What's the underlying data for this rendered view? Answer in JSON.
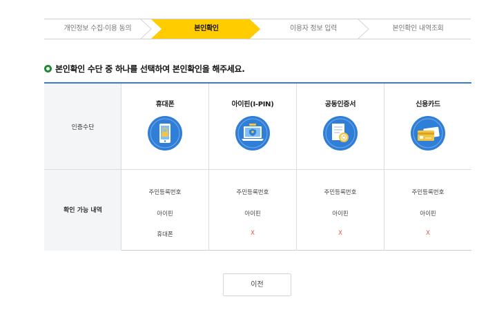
{
  "steps": [
    {
      "label": "개인정보 수집·이용 동의",
      "active": false
    },
    {
      "label": "본인확인",
      "active": true
    },
    {
      "label": "이용자 정보 입력",
      "active": false
    },
    {
      "label": "본인확인 내역조회",
      "active": false
    }
  ],
  "colors": {
    "active_step": "#ffcc00",
    "table_top_border": "#3a7bd5",
    "icon_blue": "#2f7ed8",
    "x_mark": "#e0534a",
    "heading_bullet": "#1e8a34"
  },
  "heading": "본인확인 수단 중 하나를 선택하여 본인확인을 해주세요.",
  "table": {
    "row1_label": "인증수단",
    "row2_label": "확인 가능 내역",
    "methods": [
      {
        "name": "휴대폰",
        "icon": "phone-lock-icon",
        "items": [
          "주민등록번호",
          "아이핀",
          "휴대폰"
        ]
      },
      {
        "name": "아이핀(I-PIN)",
        "icon": "laptop-ipin-icon",
        "items": [
          "주민등록번호",
          "아이핀",
          "X"
        ]
      },
      {
        "name": "공동인증서",
        "icon": "certificate-icon",
        "items": [
          "주민등록번호",
          "아이핀",
          "X"
        ]
      },
      {
        "name": "신용카드",
        "icon": "credit-card-icon",
        "items": [
          "주민등록번호",
          "아이핀",
          "X"
        ]
      }
    ]
  },
  "prev_button": "이전"
}
